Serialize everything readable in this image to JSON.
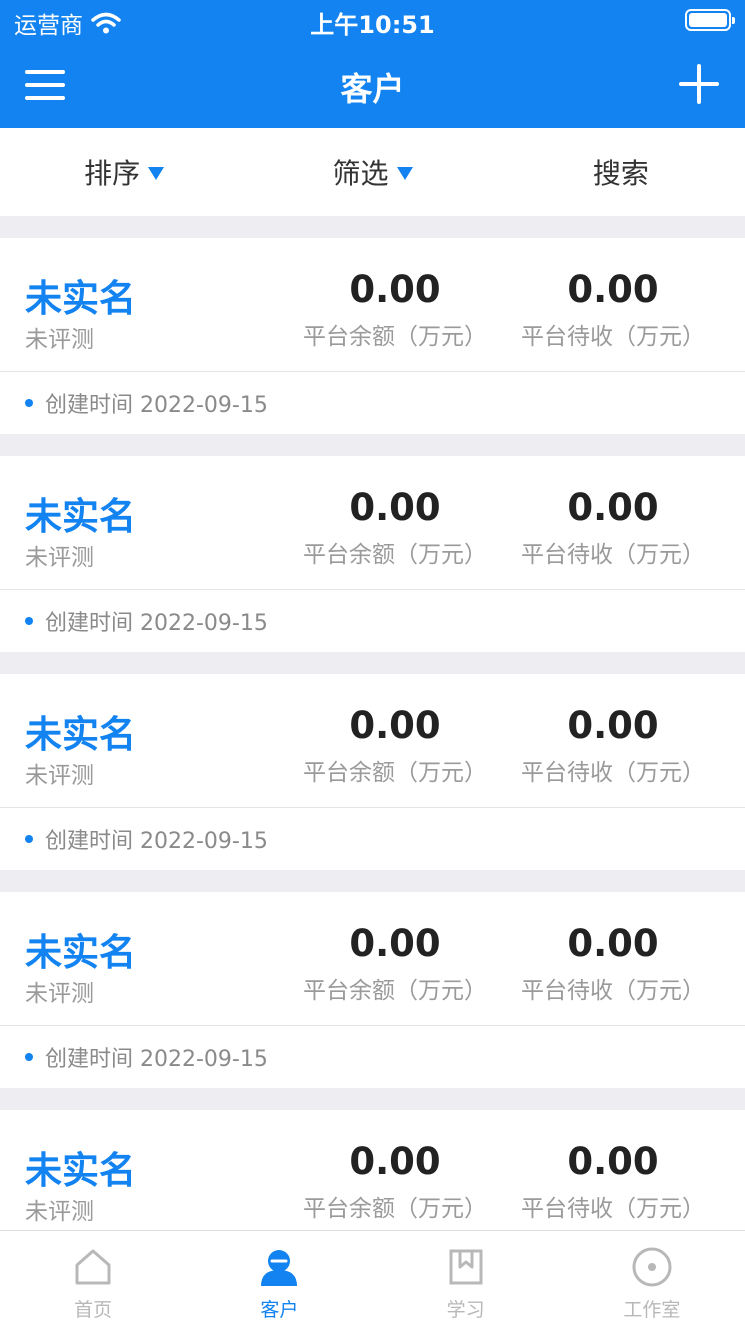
{
  "status_bar": {
    "carrier": "运营商",
    "time": "上午10:51"
  },
  "nav": {
    "title": "客户"
  },
  "filters": {
    "sort": "排序",
    "filter": "筛选",
    "search": "搜索"
  },
  "customers": [
    {
      "name": "未实名",
      "status": "未评测",
      "balance": "0.00",
      "balance_label": "平台余额（万元）",
      "pending": "0.00",
      "pending_label": "平台待收（万元）",
      "created": "创建时间 2022-09-15"
    },
    {
      "name": "未实名",
      "status": "未评测",
      "balance": "0.00",
      "balance_label": "平台余额（万元）",
      "pending": "0.00",
      "pending_label": "平台待收（万元）",
      "created": "创建时间 2022-09-15"
    },
    {
      "name": "未实名",
      "status": "未评测",
      "balance": "0.00",
      "balance_label": "平台余额（万元）",
      "pending": "0.00",
      "pending_label": "平台待收（万元）",
      "created": "创建时间 2022-09-15"
    },
    {
      "name": "未实名",
      "status": "未评测",
      "balance": "0.00",
      "balance_label": "平台余额（万元）",
      "pending": "0.00",
      "pending_label": "平台待收（万元）",
      "created": "创建时间 2022-09-15"
    },
    {
      "name": "未实名",
      "status": "未评测",
      "balance": "0.00",
      "balance_label": "平台余额（万元）",
      "pending": "0.00",
      "pending_label": "平台待收（万元）",
      "created": ""
    }
  ],
  "tabs": [
    {
      "label": "首页",
      "icon": "home-icon"
    },
    {
      "label": "客户",
      "icon": "customer-icon"
    },
    {
      "label": "学习",
      "icon": "bookmark-icon"
    },
    {
      "label": "工作室",
      "icon": "studio-icon"
    }
  ],
  "colors": {
    "accent": "#1283f0",
    "inactive": "#b8b8b8"
  }
}
